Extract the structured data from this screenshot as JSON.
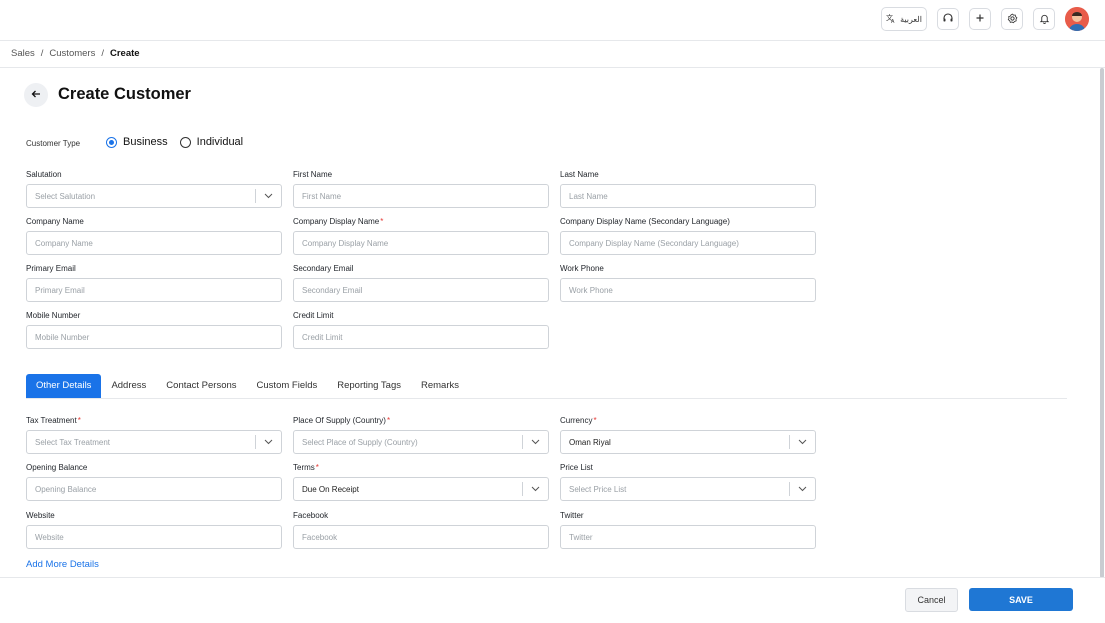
{
  "topbar": {
    "language_label": "العربية",
    "icons": [
      "translate-icon",
      "headset-icon",
      "plus-icon",
      "gear-icon",
      "bell-icon",
      "avatar"
    ]
  },
  "breadcrumb": {
    "items": [
      "Sales",
      "Customers",
      "Create"
    ],
    "separator": "/"
  },
  "page": {
    "title": "Create Customer"
  },
  "customer_type": {
    "label": "Customer Type",
    "options": [
      "Business",
      "Individual"
    ],
    "selected": "Business"
  },
  "fields": {
    "salutation": {
      "label": "Salutation",
      "placeholder": "Select Salutation"
    },
    "first_name": {
      "label": "First Name",
      "placeholder": "First Name"
    },
    "last_name": {
      "label": "Last Name",
      "placeholder": "Last Name"
    },
    "company_name": {
      "label": "Company Name",
      "placeholder": "Company Name"
    },
    "company_display_name": {
      "label": "Company Display Name",
      "placeholder": "Company Display Name",
      "required": "*"
    },
    "company_display_name_secondary": {
      "label": "Company Display Name (Secondary Language)",
      "placeholder": "Company Display Name (Secondary Language)"
    },
    "primary_email": {
      "label": "Primary Email",
      "placeholder": "Primary Email"
    },
    "secondary_email": {
      "label": "Secondary Email",
      "placeholder": "Secondary Email"
    },
    "work_phone": {
      "label": "Work Phone",
      "placeholder": "Work Phone"
    },
    "mobile_number": {
      "label": "Mobile Number",
      "placeholder": "Mobile Number"
    },
    "credit_limit": {
      "label": "Credit Limit",
      "placeholder": "Credit Limit"
    }
  },
  "tabs": {
    "items": [
      "Other Details",
      "Address",
      "Contact Persons",
      "Custom Fields",
      "Reporting Tags",
      "Remarks"
    ],
    "active": "Other Details"
  },
  "other_details": {
    "tax_treatment": {
      "label": "Tax Treatment",
      "placeholder": "Select Tax Treatment",
      "required": "*"
    },
    "place_of_supply": {
      "label": "Place Of Supply (Country)",
      "placeholder": "Select Place of Supply (Country)",
      "required": "*"
    },
    "currency": {
      "label": "Currency",
      "value": "Oman Riyal",
      "required": "*"
    },
    "opening_balance": {
      "label": "Opening Balance",
      "placeholder": "Opening Balance"
    },
    "terms": {
      "label": "Terms",
      "value": "Due On Receipt",
      "required": "*"
    },
    "price_list": {
      "label": "Price List",
      "placeholder": "Select Price List"
    },
    "website": {
      "label": "Website",
      "placeholder": "Website"
    },
    "facebook": {
      "label": "Facebook",
      "placeholder": "Facebook"
    },
    "twitter": {
      "label": "Twitter",
      "placeholder": "Twitter"
    },
    "add_more_label": "Add More Details"
  },
  "footer": {
    "cancel_label": "Cancel",
    "save_label": "SAVE"
  },
  "colors": {
    "accent": "#1a73e8",
    "save_button": "#1f77d4",
    "required": "#e53935",
    "avatar": "#e85c4a"
  }
}
